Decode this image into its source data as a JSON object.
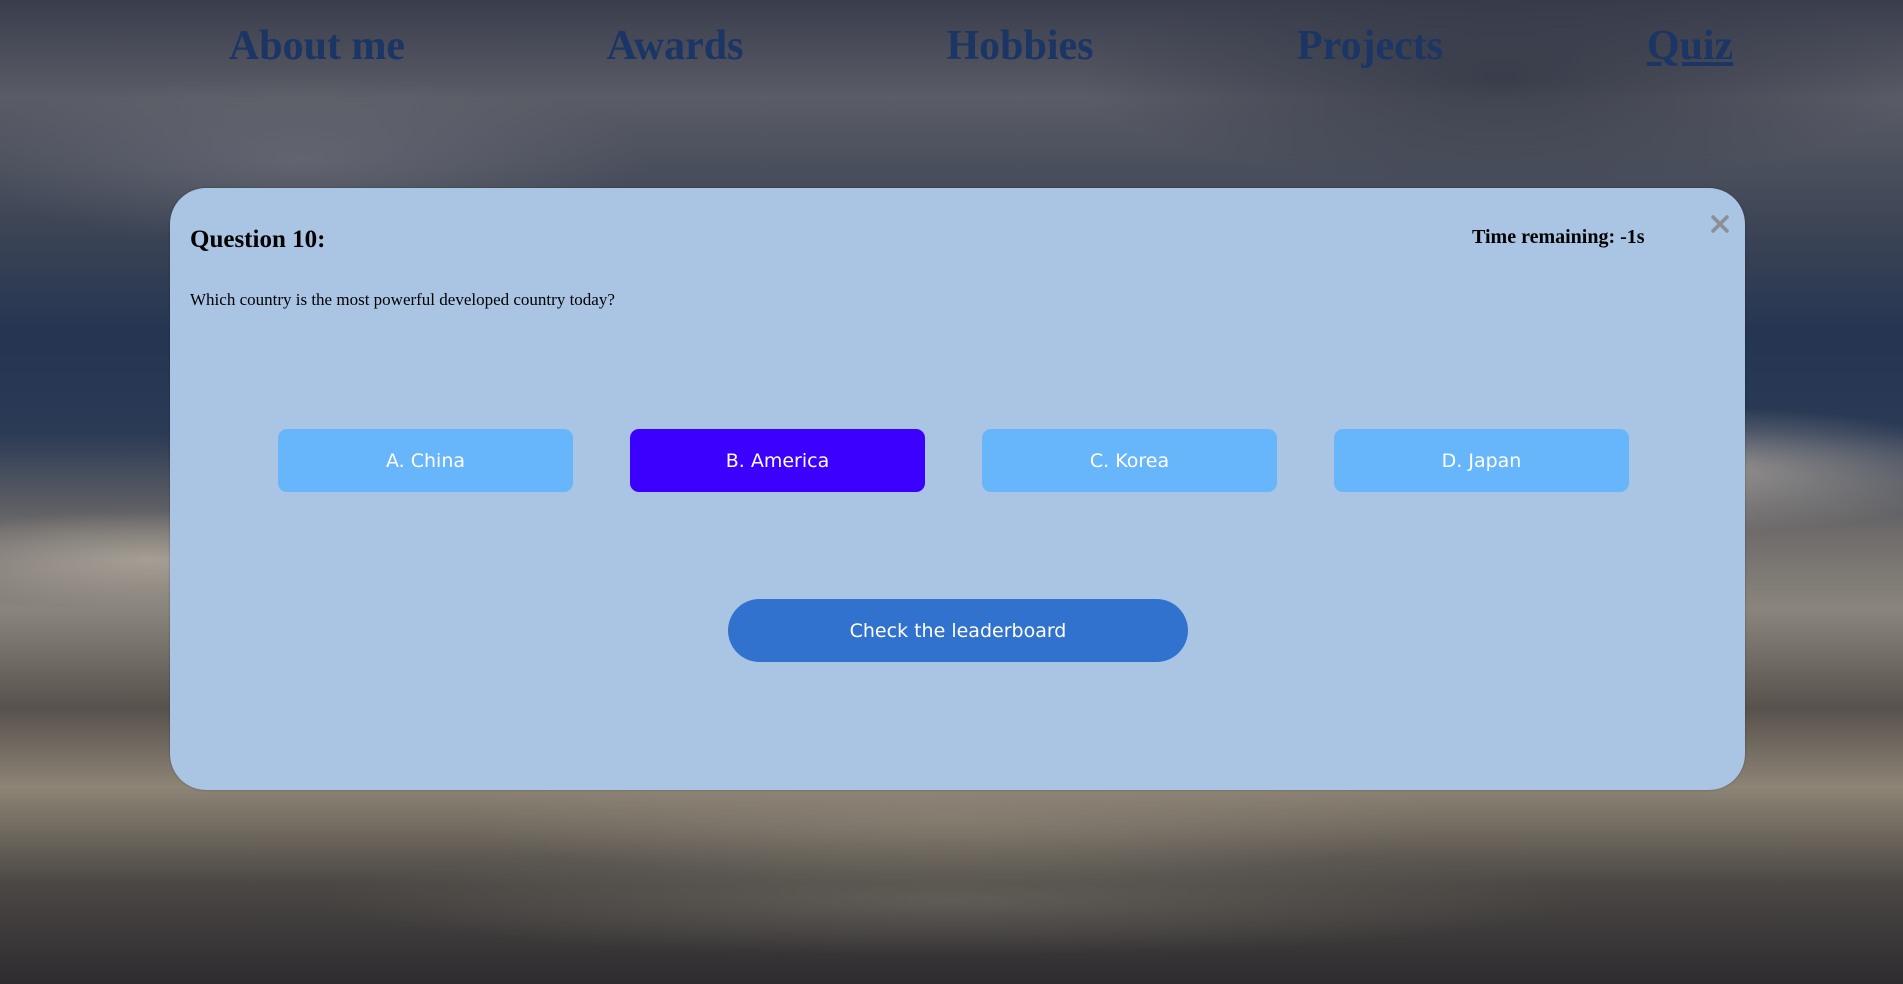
{
  "nav": {
    "items": [
      {
        "label": "About me"
      },
      {
        "label": "Awards"
      },
      {
        "label": "Hobbies"
      },
      {
        "label": "Projects"
      },
      {
        "label": "Quiz",
        "active": true
      }
    ]
  },
  "quiz": {
    "title": "Question 10:",
    "question": "Which country is the most powerful developed country today?",
    "timer": "Time remaining: -1s",
    "close_icon": "close-icon",
    "options": [
      {
        "label": "A. China",
        "selected": false
      },
      {
        "label": "B. America",
        "selected": true
      },
      {
        "label": "C. Korea",
        "selected": false
      },
      {
        "label": "D. Japan",
        "selected": false
      }
    ],
    "leaderboard_label": "Check the leaderboard"
  },
  "colors": {
    "modal_bg": "#aac4e4",
    "option_bg": "#67b6fb",
    "option_selected_bg": "#3c00ff",
    "leaderboard_bg": "#3172cf",
    "nav_link": "#1b3565"
  }
}
